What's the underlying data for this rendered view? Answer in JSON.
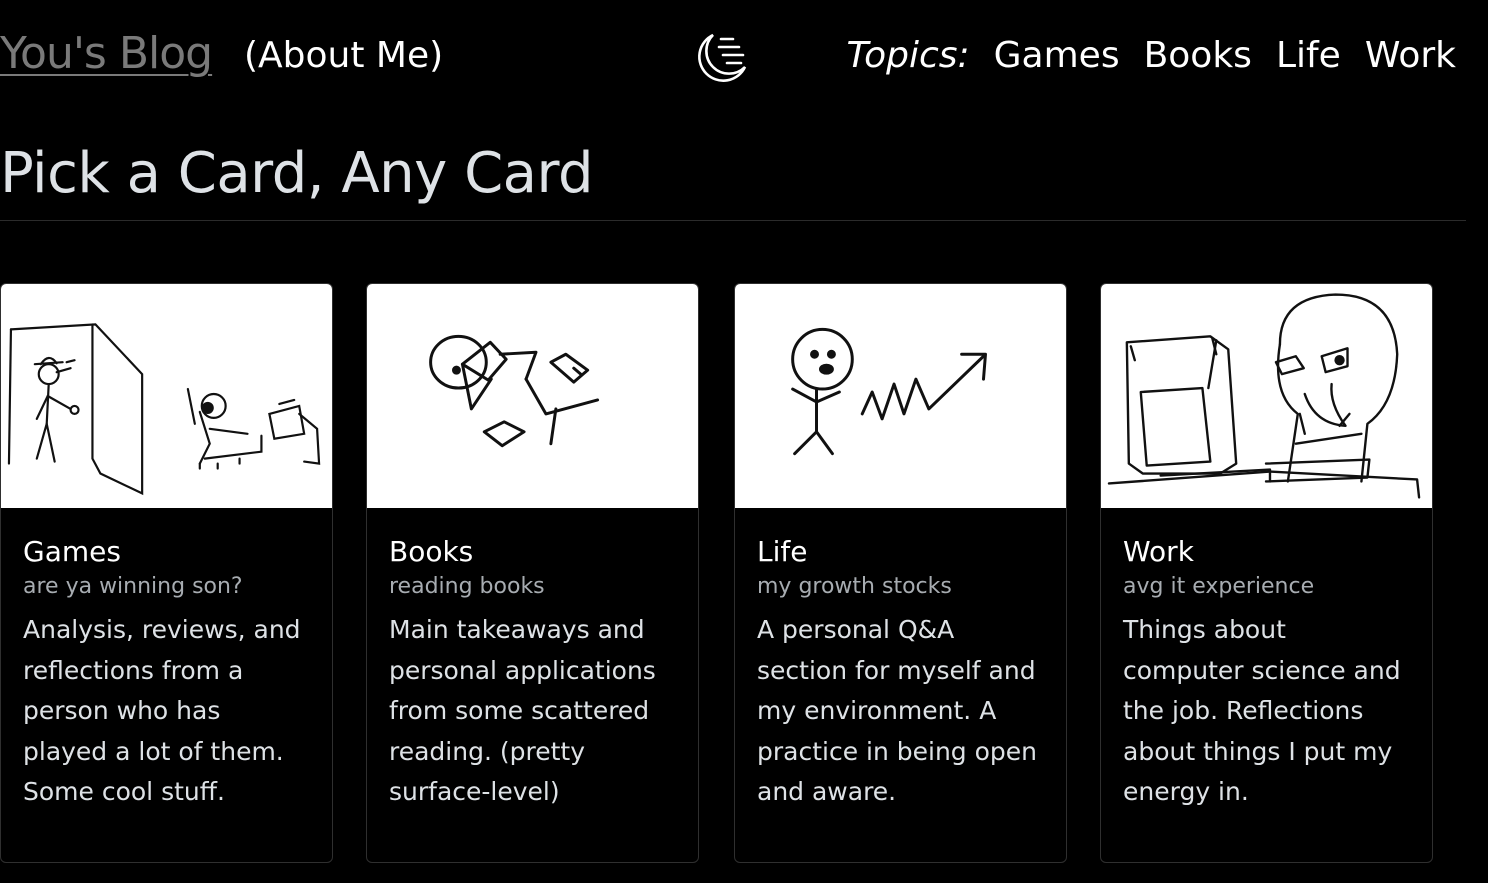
{
  "header": {
    "brand": "You's Blog",
    "about": "(About Me)",
    "theme_toggle_icon": "moon-icon",
    "topics_label": "Topics:",
    "topics": [
      "Games",
      "Books",
      "Life",
      "Work"
    ]
  },
  "main": {
    "title": "Pick a Card, Any Card",
    "cards": [
      {
        "title": "Games",
        "subtitle": "are ya winning son?",
        "text": "Analysis, reviews, and reflections from a person who has played a lot of them. Some cool stuff.",
        "image": "games-sketch"
      },
      {
        "title": "Books",
        "subtitle": "reading books",
        "text": "Main takeaways and personal applications from some scattered reading. (pretty surface-level)",
        "image": "books-sketch"
      },
      {
        "title": "Life",
        "subtitle": "my growth stocks",
        "text": "A personal Q&A section for myself and my environment. A practice in being open and aware.",
        "image": "life-sketch"
      },
      {
        "title": "Work",
        "subtitle": "avg it experience",
        "text": "Things about computer science and the job. Reflections about things I put my energy in.",
        "image": "work-sketch"
      }
    ]
  },
  "colors": {
    "background": "#000000",
    "text": "#ffffff",
    "muted": "#a7acb1",
    "brand_link": "#7a7a7a"
  }
}
